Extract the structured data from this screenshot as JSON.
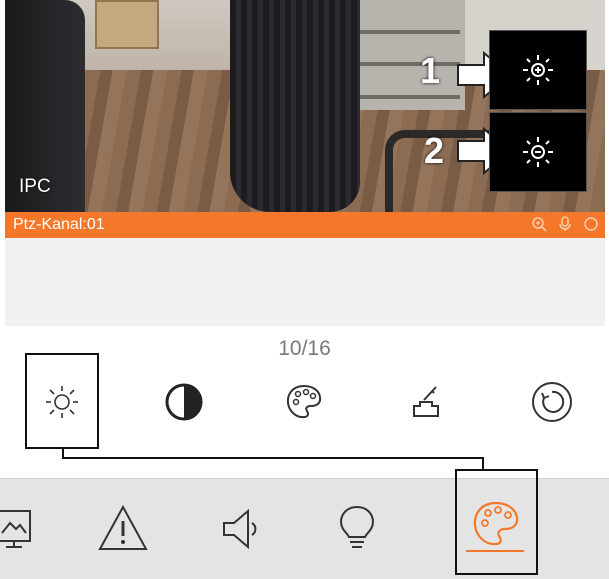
{
  "camera": {
    "overlay_label": "IPC",
    "callouts": [
      {
        "number": "1",
        "icon": "brightness-up-icon"
      },
      {
        "number": "2",
        "icon": "brightness-down-icon"
      }
    ]
  },
  "status_bar": {
    "channel_label": "Ptz-Kanal:01",
    "color": "#f5782a",
    "icons": [
      "zoom-icon",
      "microphone-icon",
      "record-icon"
    ]
  },
  "controls": {
    "page_indicator": "10/16",
    "items": [
      {
        "icon": "brightness-icon",
        "selected": true
      },
      {
        "icon": "contrast-icon"
      },
      {
        "icon": "palette-icon"
      },
      {
        "icon": "sharpness-icon"
      },
      {
        "icon": "reset-icon"
      }
    ]
  },
  "bottom_nav": {
    "items": [
      {
        "icon": "image-icon"
      },
      {
        "icon": "warning-icon"
      },
      {
        "icon": "speaker-icon"
      },
      {
        "icon": "light-bulb-icon"
      },
      {
        "icon": "palette-icon",
        "active": true
      }
    ],
    "active_color": "#f5782a"
  }
}
